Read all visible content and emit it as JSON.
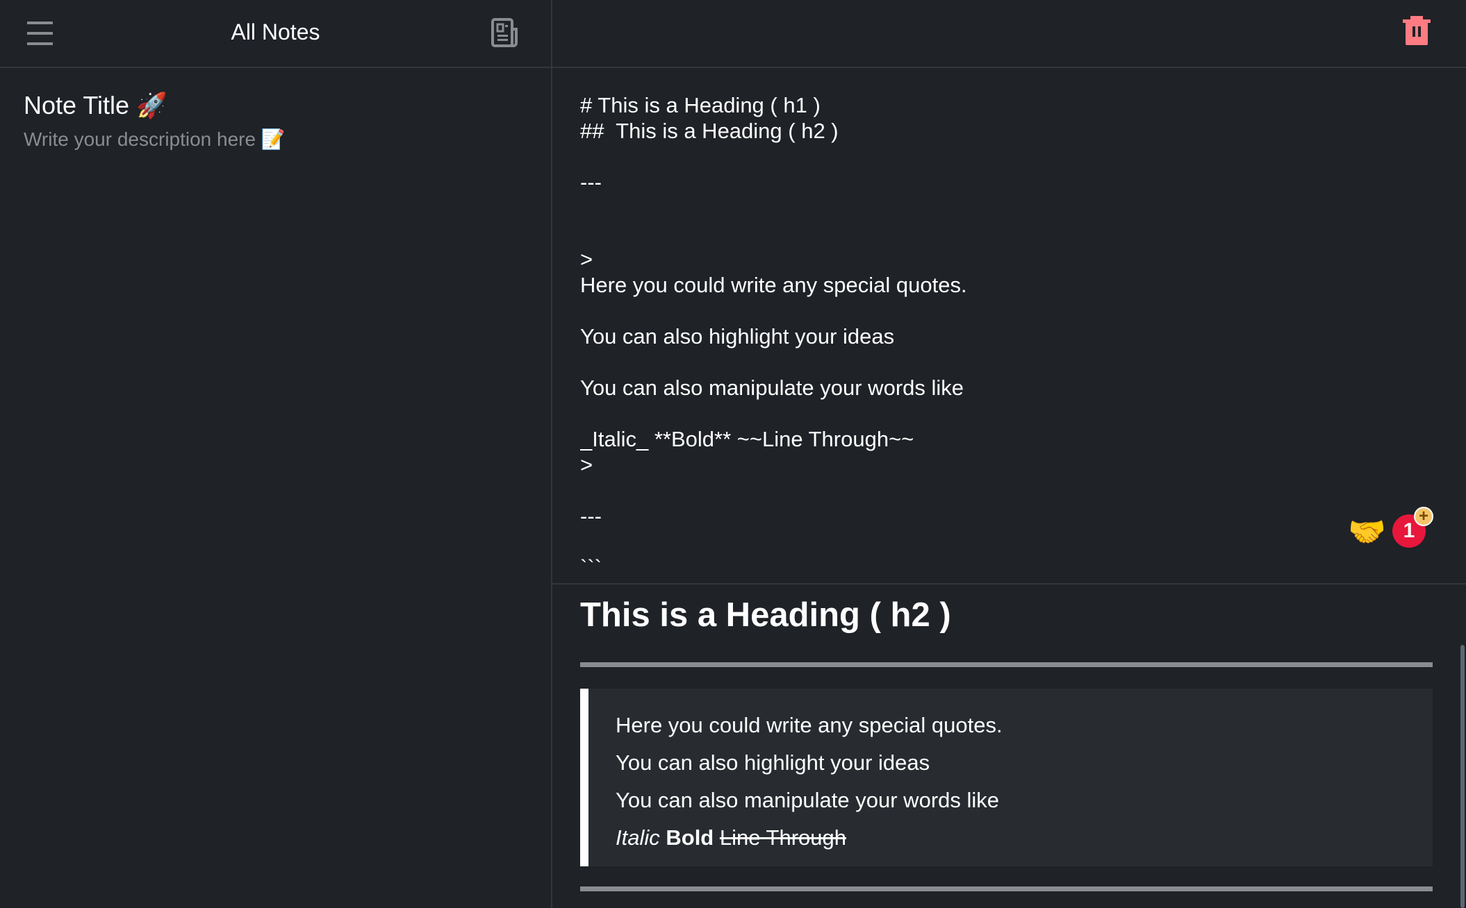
{
  "sidebar": {
    "title": "All Notes",
    "menu_icon": "hamburger-icon",
    "new_note_icon": "newspaper-icon",
    "notes": [
      {
        "title": "Note Title 🚀",
        "description": "Write your description here 📝"
      }
    ]
  },
  "main": {
    "delete_icon": "trash-icon",
    "editor": {
      "content": "# This is a Heading ( h1 )\n##  This is a Heading ( h2 )\n\n---\n\n\n>\nHere you could write any special quotes.\n\nYou can also highlight your ideas\n\nYou can also manipulate your words like\n\n_Italic_ **Bold** ~~Line Through~~\n>\n\n---\n\n```"
    },
    "widgets": {
      "handshake": "🤝",
      "badge_count": "1",
      "badge_plus": "+"
    },
    "preview": {
      "heading": "This is a Heading ( h2 )",
      "quote_lines": [
        "Here you could write any special quotes.",
        "You can also highlight your ideas",
        "You can also manipulate your words like"
      ],
      "italic": "Italic",
      "bold": "Bold",
      "strike": "Line Through"
    }
  },
  "colors": {
    "background": "#1f2227",
    "border": "#33363b",
    "trash": "#ff7b82",
    "badge": "#e8173c",
    "quote_bg": "#282c31",
    "muted": "#8a8c90"
  }
}
